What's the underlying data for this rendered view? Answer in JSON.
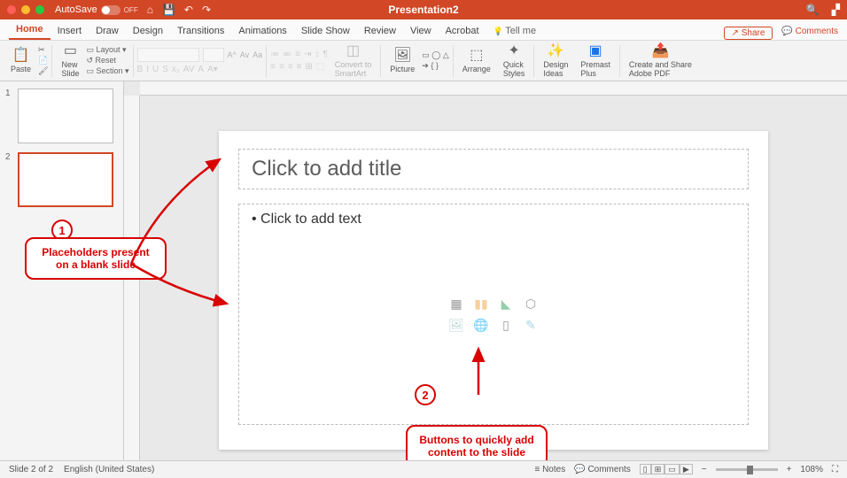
{
  "titlebar": {
    "autosave_label": "AutoSave",
    "autosave_state": "OFF",
    "title": "Presentation2"
  },
  "menu": {
    "tabs": [
      "Home",
      "Insert",
      "Draw",
      "Design",
      "Transitions",
      "Animations",
      "Slide Show",
      "Review",
      "View",
      "Acrobat"
    ],
    "active": "Home",
    "tellme": "Tell me",
    "share": "Share",
    "comments": "Comments"
  },
  "ribbon": {
    "paste": "Paste",
    "newslide": "New\nSlide",
    "layout": "Layout",
    "reset": "Reset",
    "section": "Section",
    "convert": "Convert to\nSmartArt",
    "picture": "Picture",
    "arrange": "Arrange",
    "quickstyles": "Quick\nStyles",
    "designideas": "Design\nIdeas",
    "premast": "Premast\nPlus",
    "adobe": "Create and Share\nAdobe PDF"
  },
  "thumbs": {
    "items": [
      {
        "n": "1"
      },
      {
        "n": "2"
      }
    ],
    "selected": 1
  },
  "slide": {
    "title_placeholder": "Click to add title",
    "body_placeholder": "• Click to add text"
  },
  "annotations": {
    "a1_num": "1",
    "a1_text": "Placeholders present on a blank slide",
    "a2_num": "2",
    "a2_text": "Buttons to quickly add content to the slide"
  },
  "status": {
    "slide": "Slide 2 of 2",
    "lang": "English (United States)",
    "notes": "Notes",
    "comments": "Comments",
    "zoom": "108%"
  }
}
